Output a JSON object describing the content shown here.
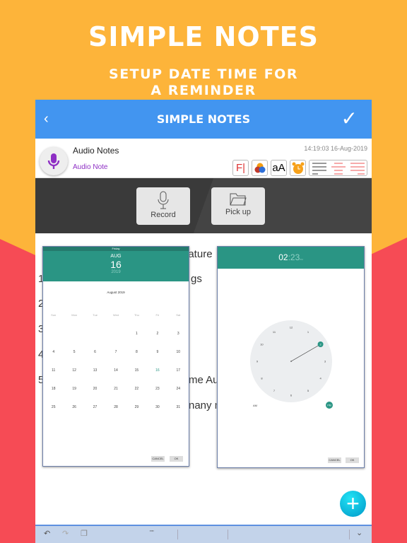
{
  "promo": {
    "title": "SIMPLE NOTES",
    "subtitle_1": "SETUP DATE TIME FOR",
    "subtitle_2": "A REMINDER"
  },
  "navbar": {
    "back_icon": "chevron-left",
    "title": "SIMPLE NOTES",
    "done_icon": "checkmark"
  },
  "note": {
    "title": "Audio Notes",
    "subtitle": "Audio Note",
    "timestamp": "14:19:03 16-Aug-2019",
    "icon": "microphone-icon",
    "tools": [
      {
        "name": "font",
        "label": "F|"
      },
      {
        "name": "color"
      },
      {
        "name": "text-size",
        "label": "aA"
      },
      {
        "name": "alarm"
      },
      {
        "name": "align"
      }
    ]
  },
  "media": {
    "record_label": "Record",
    "pickup_label": "Pick up"
  },
  "background_text": [
    "eature",
    "1",
    "gs",
    "2",
    "3",
    "4",
    "5",
    "me Au",
    "nany m"
  ],
  "date_picker": {
    "weekday": "Friday",
    "month": "AUG",
    "day": "16",
    "year": "2019",
    "month_title": "August 2019",
    "weekdays": [
      "Sun",
      "Mon",
      "Tue",
      "Wed",
      "Thu",
      "Fri",
      "Sat"
    ],
    "first_weekday_index": 4,
    "days_in_month": 31,
    "selected_day": 16,
    "cancel": "CANCEL",
    "ok": "OK",
    "accent": "#2A9584"
  },
  "time_picker": {
    "hours": "02",
    "minutes": "23",
    "ampm": "PM",
    "am_label": "AM",
    "pm_label": "PM",
    "dial": [
      "12",
      "1",
      "2",
      "3",
      "4",
      "5",
      "6",
      "7",
      "8",
      "9",
      "10",
      "11"
    ],
    "selected_hour": 2,
    "cancel": "CANCEL",
    "ok": "OK"
  },
  "toolbar": {
    "quote": "\"\""
  }
}
